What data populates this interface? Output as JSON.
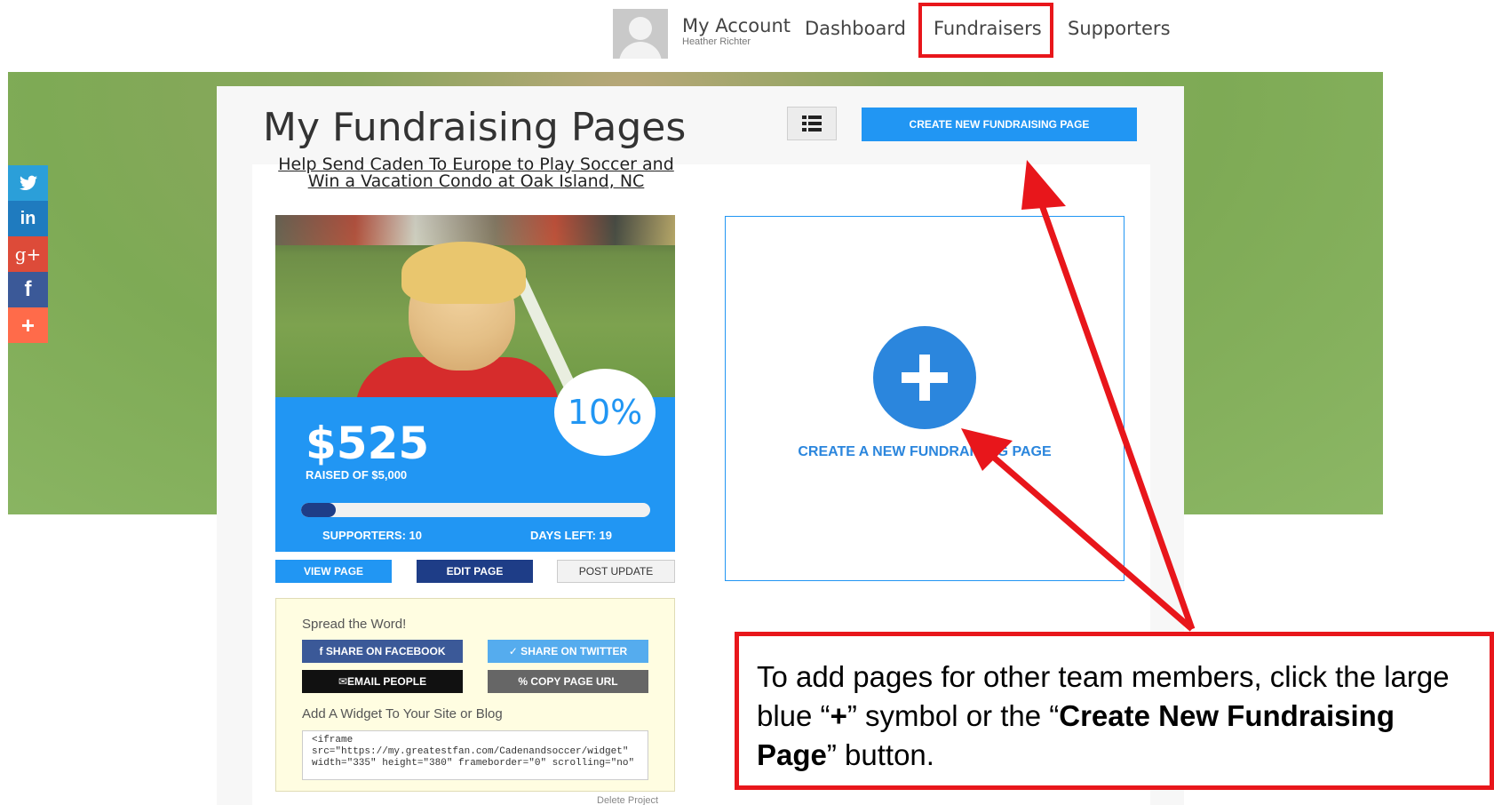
{
  "nav": {
    "account_title": "My Account",
    "account_name": "Heather Richter",
    "dashboard": "Dashboard",
    "fundraisers": "Fundraisers",
    "supporters": "Supporters"
  },
  "social": [
    {
      "icon": "twitter-icon",
      "glyph": "🐦",
      "color": "#2b9fd9"
    },
    {
      "icon": "linkedin-icon",
      "glyph": "in",
      "color": "#1f7bbf"
    },
    {
      "icon": "google-plus-icon",
      "glyph": "g+",
      "color": "#dd4b39"
    },
    {
      "icon": "facebook-icon",
      "glyph": "f",
      "color": "#3b5998"
    },
    {
      "icon": "more-share-icon",
      "glyph": "+",
      "color": "#ff6b4a"
    }
  ],
  "page": {
    "title": "My Fundraising Pages",
    "create_button": "CREATE NEW FUNDRAISING PAGE"
  },
  "fundraiser": {
    "title": "Help Send Caden To Europe to Play Soccer and Win a Vacation Condo at Oak Island, NC",
    "percent": "10%",
    "progress_fraction": 0.1,
    "amount": "$525",
    "raised_of": "RAISED OF $5,000",
    "supporters": "SUPPORTERS: 10",
    "days_left": "DAYS LEFT: 19",
    "view_page": "VIEW PAGE",
    "edit_page": "EDIT PAGE",
    "post_update": "POST UPDATE"
  },
  "spread": {
    "title": "Spread the Word!",
    "facebook": "f SHARE ON FACEBOOK",
    "twitter": "✓ SHARE ON TWITTER",
    "email": "✉EMAIL PEOPLE",
    "copy_url": "% COPY PAGE URL",
    "widget_title": "Add A Widget To Your Site or Blog",
    "widget_code": "<iframe\nsrc=\"https://my.greatestfan.com/Cadenandsoccer/widget\"\nwidth=\"335\" height=\"380\" frameborder=\"0\" scrolling=\"no\"",
    "delete": "Delete Project"
  },
  "new_page": {
    "label": "CREATE A NEW FUNDRAISING PAGE"
  },
  "callout": {
    "text_1": "To add pages for other team members, click the large blue “",
    "plus": "+",
    "text_2": "” symbol or the “",
    "bold_button": "Create New Fundraising Page",
    "text_3": "” button."
  },
  "colors": {
    "accent_blue": "#2196f3",
    "dark_blue": "#1e3d87",
    "annotation_red": "#e8161b"
  }
}
